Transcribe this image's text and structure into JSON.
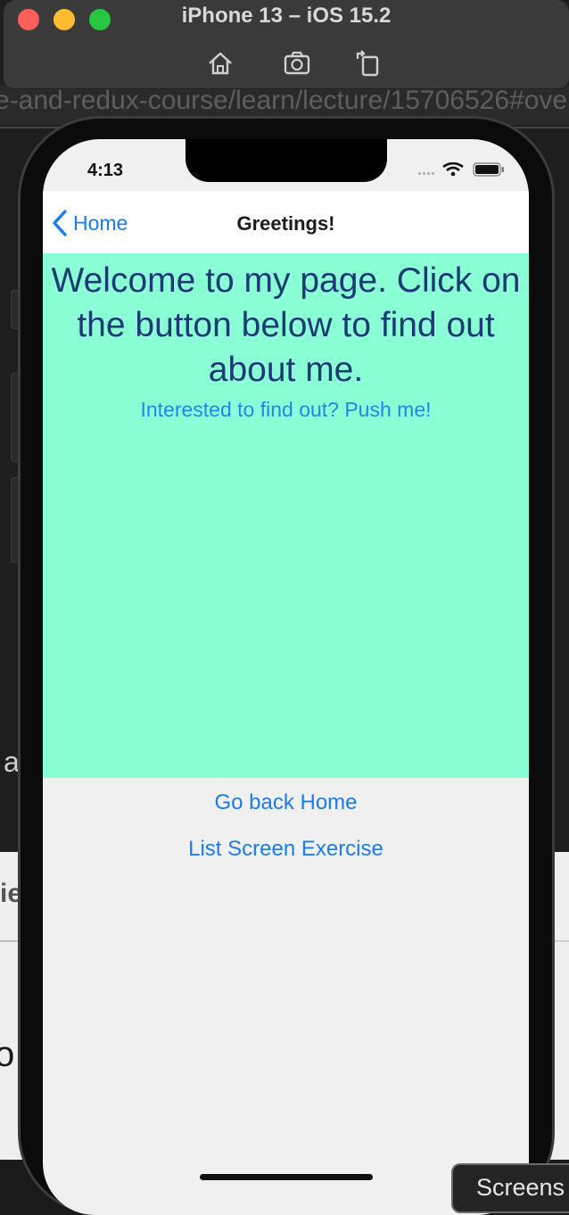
{
  "simulator": {
    "title": "iPhone 13 – iOS 15.2",
    "toolbar_icons": [
      "home-icon",
      "screenshot-icon",
      "rotate-icon"
    ]
  },
  "background": {
    "url_fragment": "e-and-redux-course/learn/lecture/15706526#ove",
    "screens_label": "Screens"
  },
  "status_bar": {
    "time": "4:13"
  },
  "nav": {
    "back_label": "Home",
    "title": "Greetings!"
  },
  "content": {
    "welcome_text": "Welcome to my page. Click on the button below to find out about me.",
    "push_link": "Interested to find out? Push me!",
    "go_back_home": "Go back Home",
    "list_screen_exercise": "List Screen Exercise"
  },
  "colors": {
    "mint_background": "#8affd6",
    "link_blue": "#1a7cf2",
    "welcome_text": "#1c3a74",
    "screen_background": "#f0f0f0"
  }
}
